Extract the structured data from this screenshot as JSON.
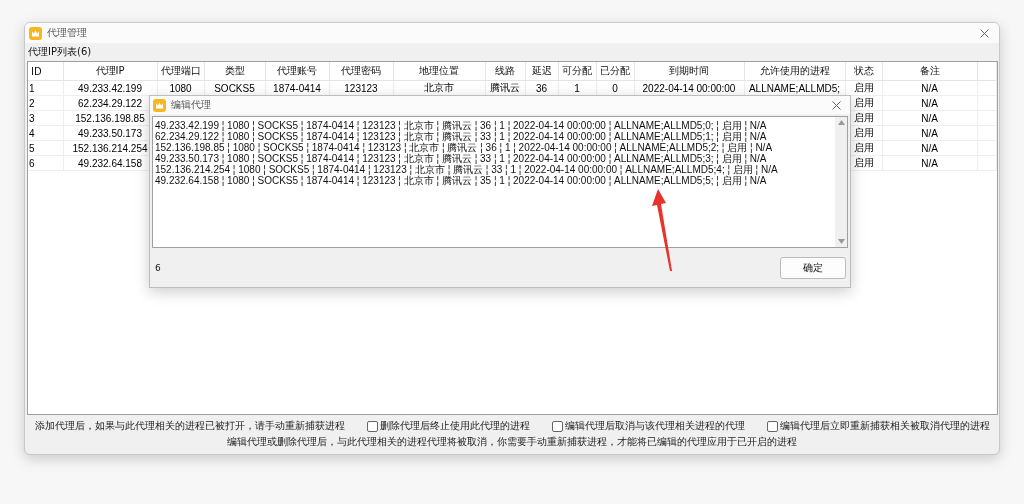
{
  "window": {
    "title": "代理管理"
  },
  "list_label": "代理IP列表(6)",
  "table": {
    "columns": [
      "ID",
      "代理IP",
      "代理端口",
      "类型",
      "代理账号",
      "代理密码",
      "地理位置",
      "线路",
      "延迟",
      "可分配",
      "已分配",
      "到期时间",
      "允许使用的进程",
      "状态",
      "备注"
    ],
    "rows": [
      {
        "cells": [
          "1",
          "49.233.42.199",
          "1080",
          "SOCKS5",
          "1874-0414",
          "123123",
          "北京市",
          "腾讯云",
          "36",
          "1",
          "0",
          "2022-04-14 00:00:00",
          "ALLNAME;ALLMD5;",
          "启用",
          "N/A"
        ]
      },
      {
        "cells": [
          "2",
          "62.234.29.122",
          null,
          null,
          null,
          null,
          null,
          null,
          null,
          null,
          null,
          null,
          null,
          "启用",
          "N/A"
        ]
      },
      {
        "cells": [
          "3",
          "152.136.198.85",
          null,
          null,
          null,
          null,
          null,
          null,
          null,
          null,
          null,
          null,
          null,
          "启用",
          "N/A"
        ]
      },
      {
        "cells": [
          "4",
          "49.233.50.173",
          null,
          null,
          null,
          null,
          null,
          null,
          null,
          null,
          null,
          null,
          null,
          "启用",
          "N/A"
        ]
      },
      {
        "cells": [
          "5",
          "152.136.214.254",
          null,
          null,
          null,
          null,
          null,
          null,
          null,
          null,
          null,
          null,
          null,
          "启用",
          "N/A"
        ]
      },
      {
        "cells": [
          "6",
          "49.232.64.158",
          null,
          null,
          null,
          null,
          null,
          null,
          null,
          null,
          null,
          null,
          null,
          "启用",
          "N/A"
        ]
      }
    ]
  },
  "footer": {
    "hint": "添加代理后，如果与此代理相关的进程已被打开，请手动重新捕获进程",
    "options": [
      {
        "label": "删除代理后终止使用此代理的进程",
        "checked": false
      },
      {
        "label": "编辑代理后取消与该代理相关进程的代理",
        "checked": false
      },
      {
        "label": "编辑代理后立即重新捕获相关被取消代理的进程",
        "checked": false
      }
    ],
    "note": "编辑代理或删除代理后，与此代理相关的进程代理将被取消，你需要手动重新捕获进程，才能将已编辑的代理应用于已开启的进程"
  },
  "dialog": {
    "title": "编辑代理",
    "lines": [
      "49.233.42.199 ¦ 1080 ¦ SOCKS5 ¦ 1874-0414 ¦ 123123 ¦ 北京市 ¦ 腾讯云 ¦ 36 ¦ 1 ¦ 2022-04-14 00:00:00 ¦ ALLNAME;ALLMD5;0; ¦ 启用 ¦ N/A",
      "62.234.29.122 ¦ 1080 ¦ SOCKS5 ¦ 1874-0414 ¦ 123123 ¦ 北京市 ¦ 腾讯云 ¦ 33 ¦ 1 ¦ 2022-04-14 00:00:00 ¦ ALLNAME;ALLMD5;1; ¦ 启用 ¦ N/A",
      "152.136.198.85 ¦ 1080 ¦ SOCKS5 ¦ 1874-0414 ¦ 123123 ¦ 北京市 ¦ 腾讯云 ¦ 36 ¦ 1 ¦ 2022-04-14 00:00:00 ¦ ALLNAME;ALLMD5;2; ¦ 启用 ¦ N/A",
      "49.233.50.173 ¦ 1080 ¦ SOCKS5 ¦ 1874-0414 ¦ 123123 ¦ 北京市 ¦ 腾讯云 ¦ 33 ¦ 1 ¦ 2022-04-14 00:00:00 ¦ ALLNAME;ALLMD5;3; ¦ 启用 ¦ N/A",
      "152.136.214.254 ¦ 1080 ¦ SOCKS5 ¦ 1874-0414 ¦ 123123 ¦ 北京市 ¦ 腾讯云 ¦ 33 ¦ 1 ¦ 2022-04-14 00:00:00 ¦ ALLNAME;ALLMD5;4; ¦ 启用 ¦ N/A",
      "49.232.64.158 ¦ 1080 ¦ SOCKS5 ¦ 1874-0414 ¦ 123123 ¦ 北京市 ¦ 腾讯云 ¦ 35 ¦ 1 ¦ 2022-04-14 00:00:00 ¦ ALLNAME;ALLMD5;5; ¦ 启用 ¦ N/A"
    ],
    "count": "6",
    "ok_button": "确定"
  }
}
